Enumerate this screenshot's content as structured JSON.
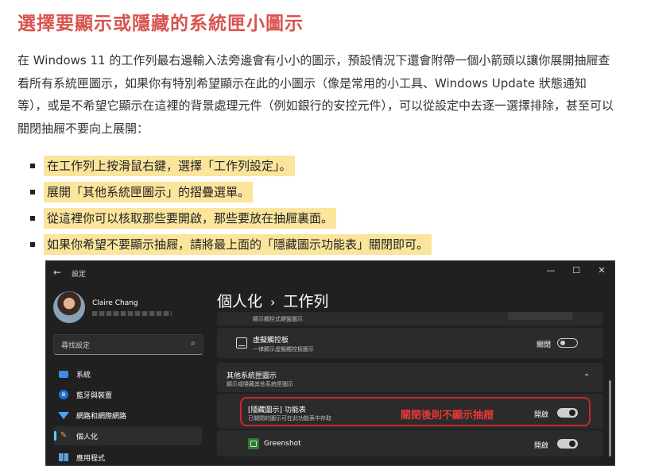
{
  "article": {
    "title": "選擇要顯示或隱藏的系統匣小圖示",
    "intro": "在 Windows 11 的工作列最右邊輸入法旁邊會有小小的圖示，預設情況下還會附帶一個小箭頭以讓你展開抽屜查看所有系統匣圖示，如果你有特別希望顯示在此的小圖示（像是常用的小工具、Windows Update 狀態通知等），或是不希望它顯示在這裡的背景處理元件（例如銀行的安控元件），可以從設定中去逐一選擇排除，甚至可以關閉抽屜不要向上展開：",
    "steps": [
      "在工作列上按滑鼠右鍵，選擇「工作列設定」。",
      "展開「其他系統匣圖示」的摺疊選單。",
      "從這裡你可以核取那些要開啟，那些要放在抽屜裏面。",
      "如果你希望不要顯示抽屜，請將最上面的「隱藏圖示功能表」關閉即可。"
    ],
    "colors": {
      "title": "#d9534f",
      "highlight": "#fbe59c"
    }
  },
  "window": {
    "title": "設定",
    "icons": {
      "back": "←",
      "minimize": "—",
      "maximize": "☐",
      "close": "✕"
    },
    "user": {
      "name": "Claire Chang"
    },
    "search": {
      "placeholder": "尋找設定",
      "icon": "⌕"
    },
    "nav": [
      {
        "label": "系統",
        "icon": "monitor"
      },
      {
        "label": "藍牙與裝置",
        "icon": "bluetooth"
      },
      {
        "label": "網路和網際網路",
        "icon": "wifi"
      },
      {
        "label": "個人化",
        "icon": "brush",
        "active": true
      },
      {
        "label": "應用程式",
        "icon": "apps"
      }
    ],
    "breadcrumb": {
      "parent": "個人化",
      "separator": "›",
      "current": "工作列"
    },
    "rows": {
      "partial_top": "顯示觸控式鍵盤圖示",
      "virtual_touchpad": {
        "title": "虛擬觸控板",
        "subtitle": "一律顯示虛擬觸控板圖示",
        "state_label": "關閉",
        "on": false
      },
      "other_icons": {
        "title": "其他系統匣圖示",
        "subtitle": "顯示或隱藏其他系統匣圖示",
        "expanded": true,
        "chevron": "⌃"
      },
      "hidden_menu": {
        "title": "[隱藏圖示] 功能表",
        "subtitle": "已關閉的圖示可在此功能表中存取",
        "state_label": "開啟",
        "on": true
      },
      "greenshot": {
        "title": "Greenshot",
        "state_label": "開啟",
        "on": true
      }
    },
    "annotation": "關閉後則不顯示抽屜",
    "accent": "#60cdff",
    "annotation_color": "#e53935"
  }
}
